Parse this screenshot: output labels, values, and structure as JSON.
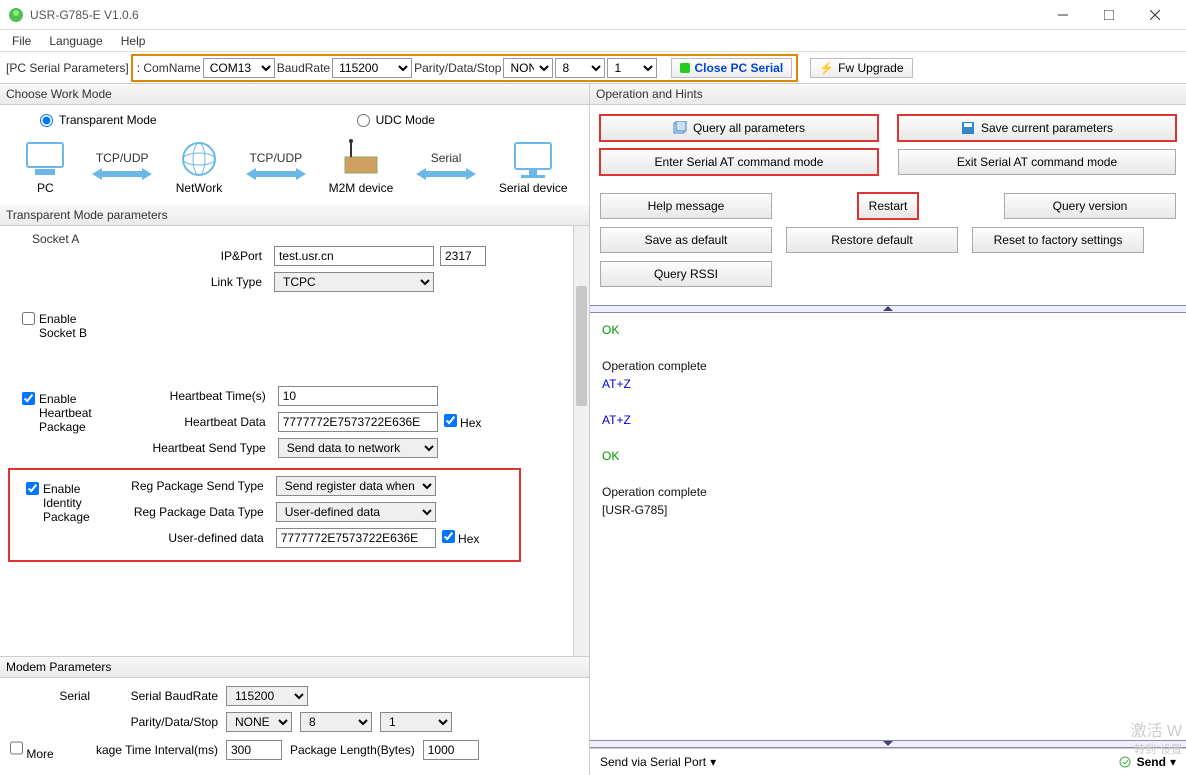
{
  "window": {
    "title": "USR-G785-E V1.0.6"
  },
  "menu": {
    "file": "File",
    "language": "Language",
    "help": "Help"
  },
  "toolbar": {
    "pc_serial_label": "[PC Serial Parameters]",
    "comname_lbl": ": ComName",
    "comname": "COM13",
    "baud_lbl": "BaudRate",
    "baud": "115200",
    "pds_lbl": "Parity/Data/Stop",
    "parity": "NONE",
    "data": "8",
    "stop": "1",
    "close_serial": "Close PC Serial",
    "fw_upgrade": "Fw Upgrade"
  },
  "workmode": {
    "hdr": "Choose Work Mode",
    "transparent": "Transparent Mode",
    "udc": "UDC Mode",
    "tcpudp": "TCP/UDP",
    "serial": "Serial",
    "pc": "PC",
    "network": "NetWork",
    "m2m": "M2M device",
    "serial_device": "Serial device"
  },
  "params": {
    "hdr": "Transparent Mode parameters",
    "socket_a": "Socket A",
    "ipport_lbl": "IP&Port",
    "ip": "test.usr.cn",
    "port": "2317",
    "linktype_lbl": "Link Type",
    "linktype": "TCPC",
    "enable_b_lbl1": "Enable",
    "enable_b_lbl2": "Socket B",
    "enable_hb_lbl1": "Enable",
    "enable_hb_lbl2": "Heartbeat",
    "enable_hb_lbl3": "Package",
    "hb_time_lbl": "Heartbeat Time(s)",
    "hb_time": "10",
    "hb_data_lbl": "Heartbeat Data",
    "hb_data": "7777772E7573722E636E",
    "hex": "Hex",
    "hb_type_lbl": "Heartbeat Send Type",
    "hb_type": "Send data to network",
    "enable_id_lbl1": "Enable",
    "enable_id_lbl2": "Identity",
    "enable_id_lbl3": "Package",
    "reg_send_lbl": "Reg Package Send Type",
    "reg_send": "Send register data when",
    "reg_data_lbl": "Reg Package Data Type",
    "reg_data": "User-defined data",
    "ud_lbl": "User-defined data",
    "ud_data": "7777772E7573722E636E"
  },
  "modem": {
    "hdr": "Modem Parameters",
    "serial_lbl": "Serial",
    "baud_lbl": "Serial BaudRate",
    "baud": "115200",
    "pds_lbl": "Parity/Data/Stop",
    "parity": "NONE",
    "data": "8",
    "stop": "1",
    "interval_lbl": "kage Time Interval(ms)",
    "interval": "300",
    "pkglen_lbl": "Package Length(Bytes)",
    "pkglen": "1000",
    "more": "More"
  },
  "ops": {
    "hdr": "Operation and Hints",
    "query_all": "Query all parameters",
    "save_params": "Save current parameters",
    "enter_at": "Enter Serial AT command mode",
    "exit_at": "Exit Serial AT command mode",
    "help": "Help message",
    "restart": "Restart",
    "query_ver": "Query version",
    "save_def": "Save as default",
    "restore_def": "Restore default",
    "reset_fac": "Reset to factory settings",
    "query_rssi": "Query RSSI"
  },
  "log": {
    "l1": "OK",
    "l2": "Operation complete",
    "l3": "AT+Z",
    "l4": "AT+Z",
    "l5": "OK",
    "l6": "Operation complete",
    "l7": "[USR-G785]"
  },
  "send": {
    "via": "Send via Serial Port",
    "send": "Send"
  },
  "watermark": {
    "a": "激活 W",
    "b": "转到\"设置"
  }
}
